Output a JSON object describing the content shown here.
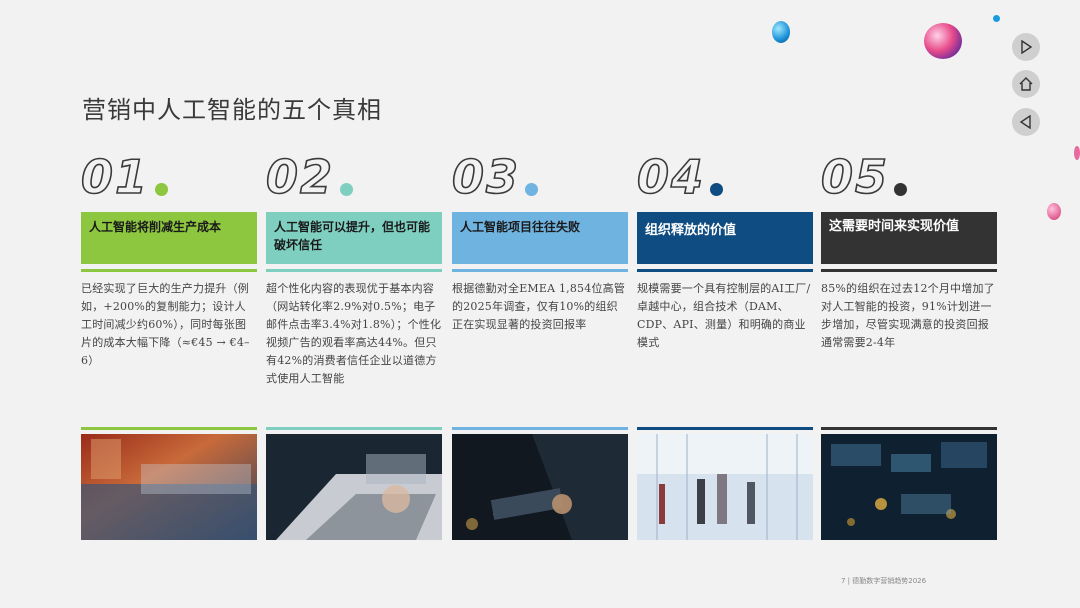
{
  "page": {
    "title": "营销中人工智能的五个真相",
    "footer": "7 | 德勤数字营销趋势2026"
  },
  "nav": {
    "next_icon": "play-icon",
    "home_icon": "home-icon",
    "prev_icon": "back-icon"
  },
  "columns": [
    {
      "number": "01",
      "accent": "#8dc63f",
      "band_color": "#8dc63f",
      "band_text_light": false,
      "heading": "人工智能将削减生产成本",
      "body": "已经实现了巨大的生产力提升（例如，+200%的复制能力；设计人工时间减少约60%），同时每张图片的成本大幅下降（≈€45 → €4–6）",
      "photo": "factory-icon"
    },
    {
      "number": "02",
      "accent": "#7fcfc0",
      "band_color": "#7fcfc0",
      "band_text_light": false,
      "heading": "人工智能可以提升，但也可能破坏信任",
      "body": "超个性化内容的表现优于基本内容（网站转化率2.9%对0.5%；电子邮件点击率3.4%对1.8%）；个性化视频广告的观看率高达44%。但只有42%的消费者信任企业以道德方式使用人工智能",
      "photo": "laptop-icon"
    },
    {
      "number": "03",
      "accent": "#6fb3e0",
      "band_color": "#6fb3e0",
      "band_text_light": false,
      "heading": "人工智能项目往往失败",
      "body": "根据德勤对全EMEA 1,854位高管的2025年调查，仅有10%的组织正在实现显著的投资回报率",
      "photo": "tablet-icon"
    },
    {
      "number": "04",
      "accent": "#0f4c81",
      "band_color": "#0f4c81",
      "band_text_light": true,
      "heading": "组织释放的价值",
      "body": "规模需要一个具有控制层的AI工厂/卓越中心，组合技术（DAM、CDP、API、测量）和明确的商业模式",
      "photo": "office-icon"
    },
    {
      "number": "05",
      "accent": "#333333",
      "band_color": "#333333",
      "band_text_light": true,
      "heading": "这需要时间来实现价值",
      "body": "85%的组织在过去12个月中增加了对人工智能的投资，91%计划进一步增加，尽管实现满意的投资回报通常需要2-4年",
      "photo": "dashboard-icon"
    }
  ]
}
